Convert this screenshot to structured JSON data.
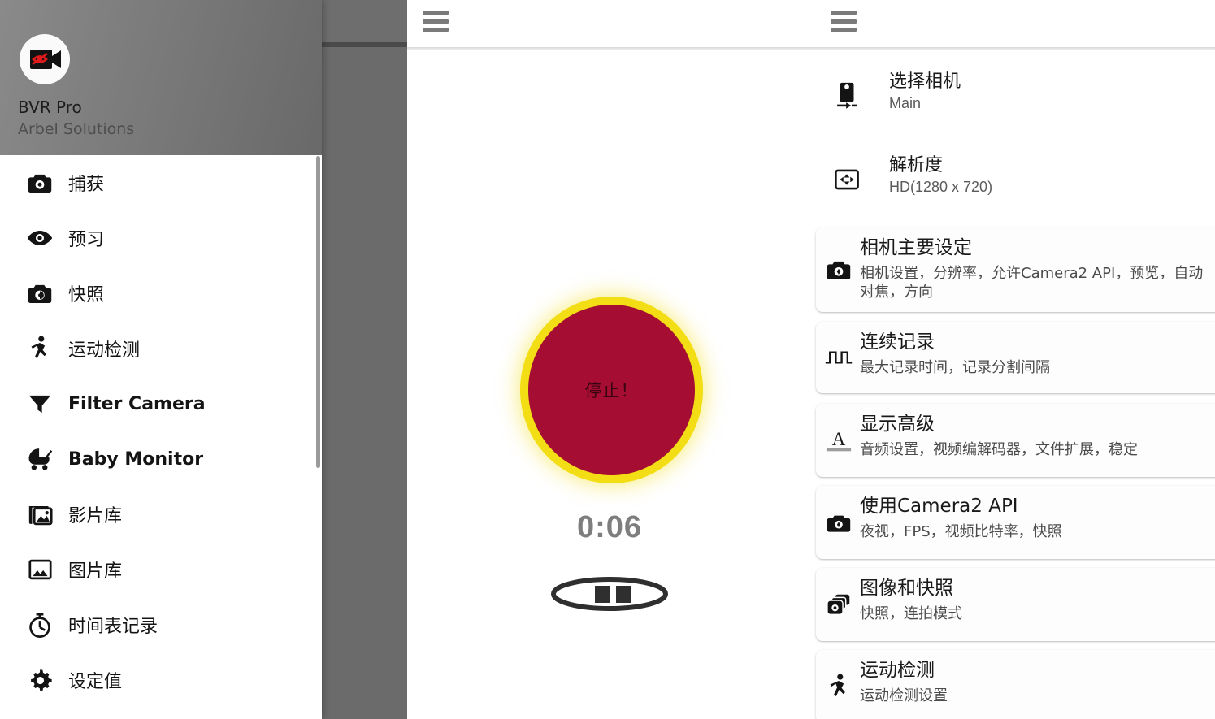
{
  "drawer": {
    "app_name": "BVR Pro",
    "vendor": "Arbel Solutions",
    "logo_icon": "video-camera-no-eye-icon",
    "items": [
      {
        "label": "捕获",
        "icon": "camera-icon",
        "bold": false
      },
      {
        "label": "预习",
        "icon": "eye-icon",
        "bold": false
      },
      {
        "label": "快照",
        "icon": "snapshot-camera-icon",
        "bold": false
      },
      {
        "label": "运动检测",
        "icon": "running-person-icon",
        "bold": false
      },
      {
        "label": "Filter Camera",
        "icon": "funnel-filter-icon",
        "bold": true
      },
      {
        "label": "Baby Monitor",
        "icon": "stroller-icon",
        "bold": true
      },
      {
        "label": "影片库",
        "icon": "video-library-icon",
        "bold": false
      },
      {
        "label": "图片库",
        "icon": "photo-library-icon",
        "bold": false
      },
      {
        "label": "时间表记录",
        "icon": "stopwatch-icon",
        "bold": false
      },
      {
        "label": "设定值",
        "icon": "gear-icon",
        "bold": false
      }
    ]
  },
  "middle_pane": {
    "menu_icon": "hamburger-menu-icon",
    "record_button_label": "停止！",
    "record_button_color": "#A50E32",
    "record_glow_color": "#F3DD14",
    "timer": "0:06",
    "pause_icon": "pause-button-icon"
  },
  "settings_pane": {
    "menu_icon": "hamburger-menu-icon",
    "rows": [
      {
        "title": "选择相机",
        "value": "Main",
        "icon": "select-camera-icon"
      },
      {
        "title": "解析度",
        "value": "HD(1280 x 720)",
        "icon": "resolution-icon"
      }
    ],
    "cards": [
      {
        "title": "相机主要设定",
        "subtitle": "相机设置，分辨率，允许Camera2 API，预览，自动对焦，方向",
        "icon": "camera-settings-icon"
      },
      {
        "title": "连续记录",
        "subtitle": "最大记录时间，记录分割间隔",
        "icon": "square-wave-icon"
      },
      {
        "title": "显示高级",
        "subtitle": "音频设置，视频编解码器，文件扩展，稳定",
        "icon": "letter-a-underline-icon"
      },
      {
        "title": "使用Camera2 API",
        "subtitle": "夜视，FPS，视频比特率，快照",
        "icon": "camera-api-icon"
      },
      {
        "title": "图像和快照",
        "subtitle": "快照，连拍模式",
        "icon": "photo-stack-icon"
      },
      {
        "title": "运动检测",
        "subtitle": "运动检测设置",
        "icon": "running-person-icon"
      }
    ]
  }
}
